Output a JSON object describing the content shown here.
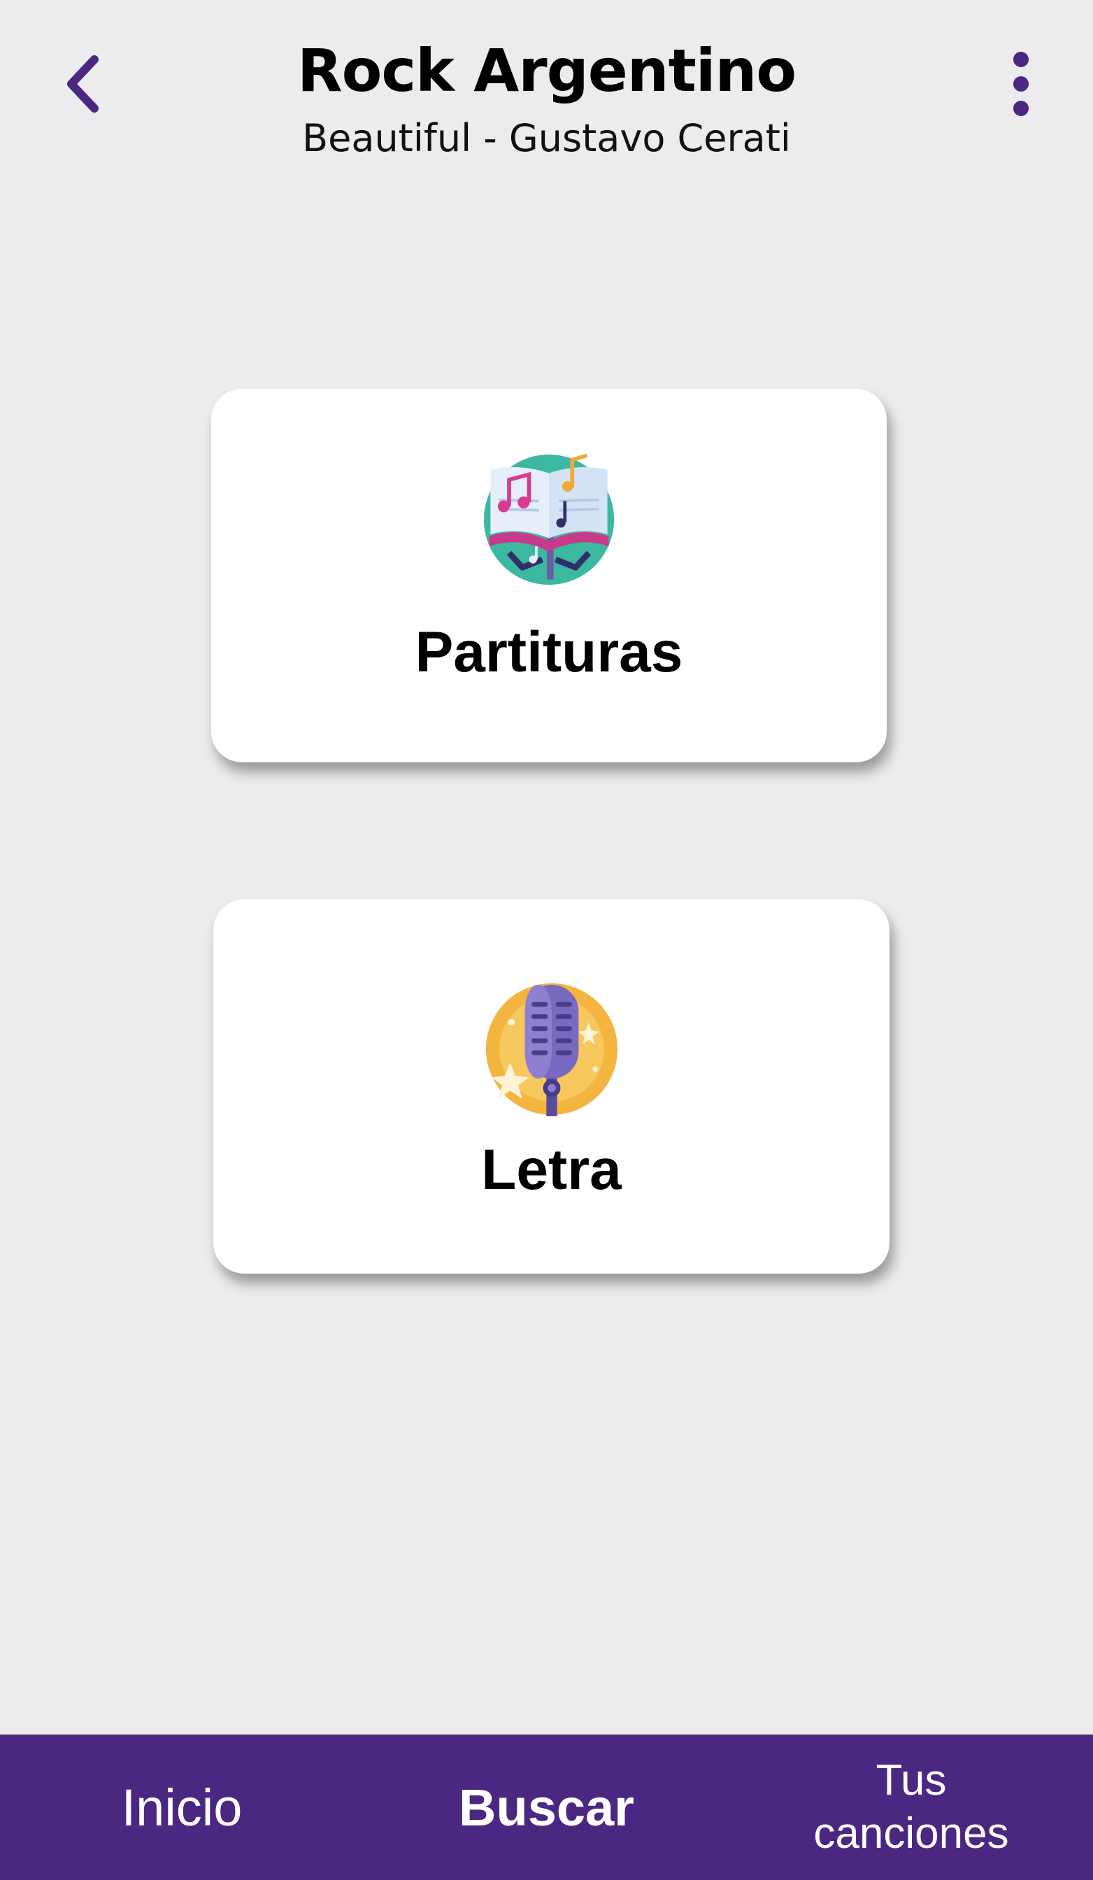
{
  "header": {
    "title": "Rock Argentino",
    "subtitle": "Beautiful - Gustavo Cerati",
    "back_icon": "chevron-left-icon",
    "menu_icon": "more-vertical-icon"
  },
  "cards": [
    {
      "label": "Partituras",
      "icon": "sheet-music-book-icon"
    },
    {
      "label": "Letra",
      "icon": "microphone-icon"
    }
  ],
  "bottom_nav": {
    "items": [
      {
        "label": "Inicio",
        "active": false
      },
      {
        "label": "Buscar",
        "active": true
      },
      {
        "label_line1": "Tus",
        "label_line2": "canciones",
        "active": false
      }
    ]
  },
  "colors": {
    "accent": "#4A2882",
    "background": "#ECECEE",
    "card": "#FFFFFF"
  }
}
